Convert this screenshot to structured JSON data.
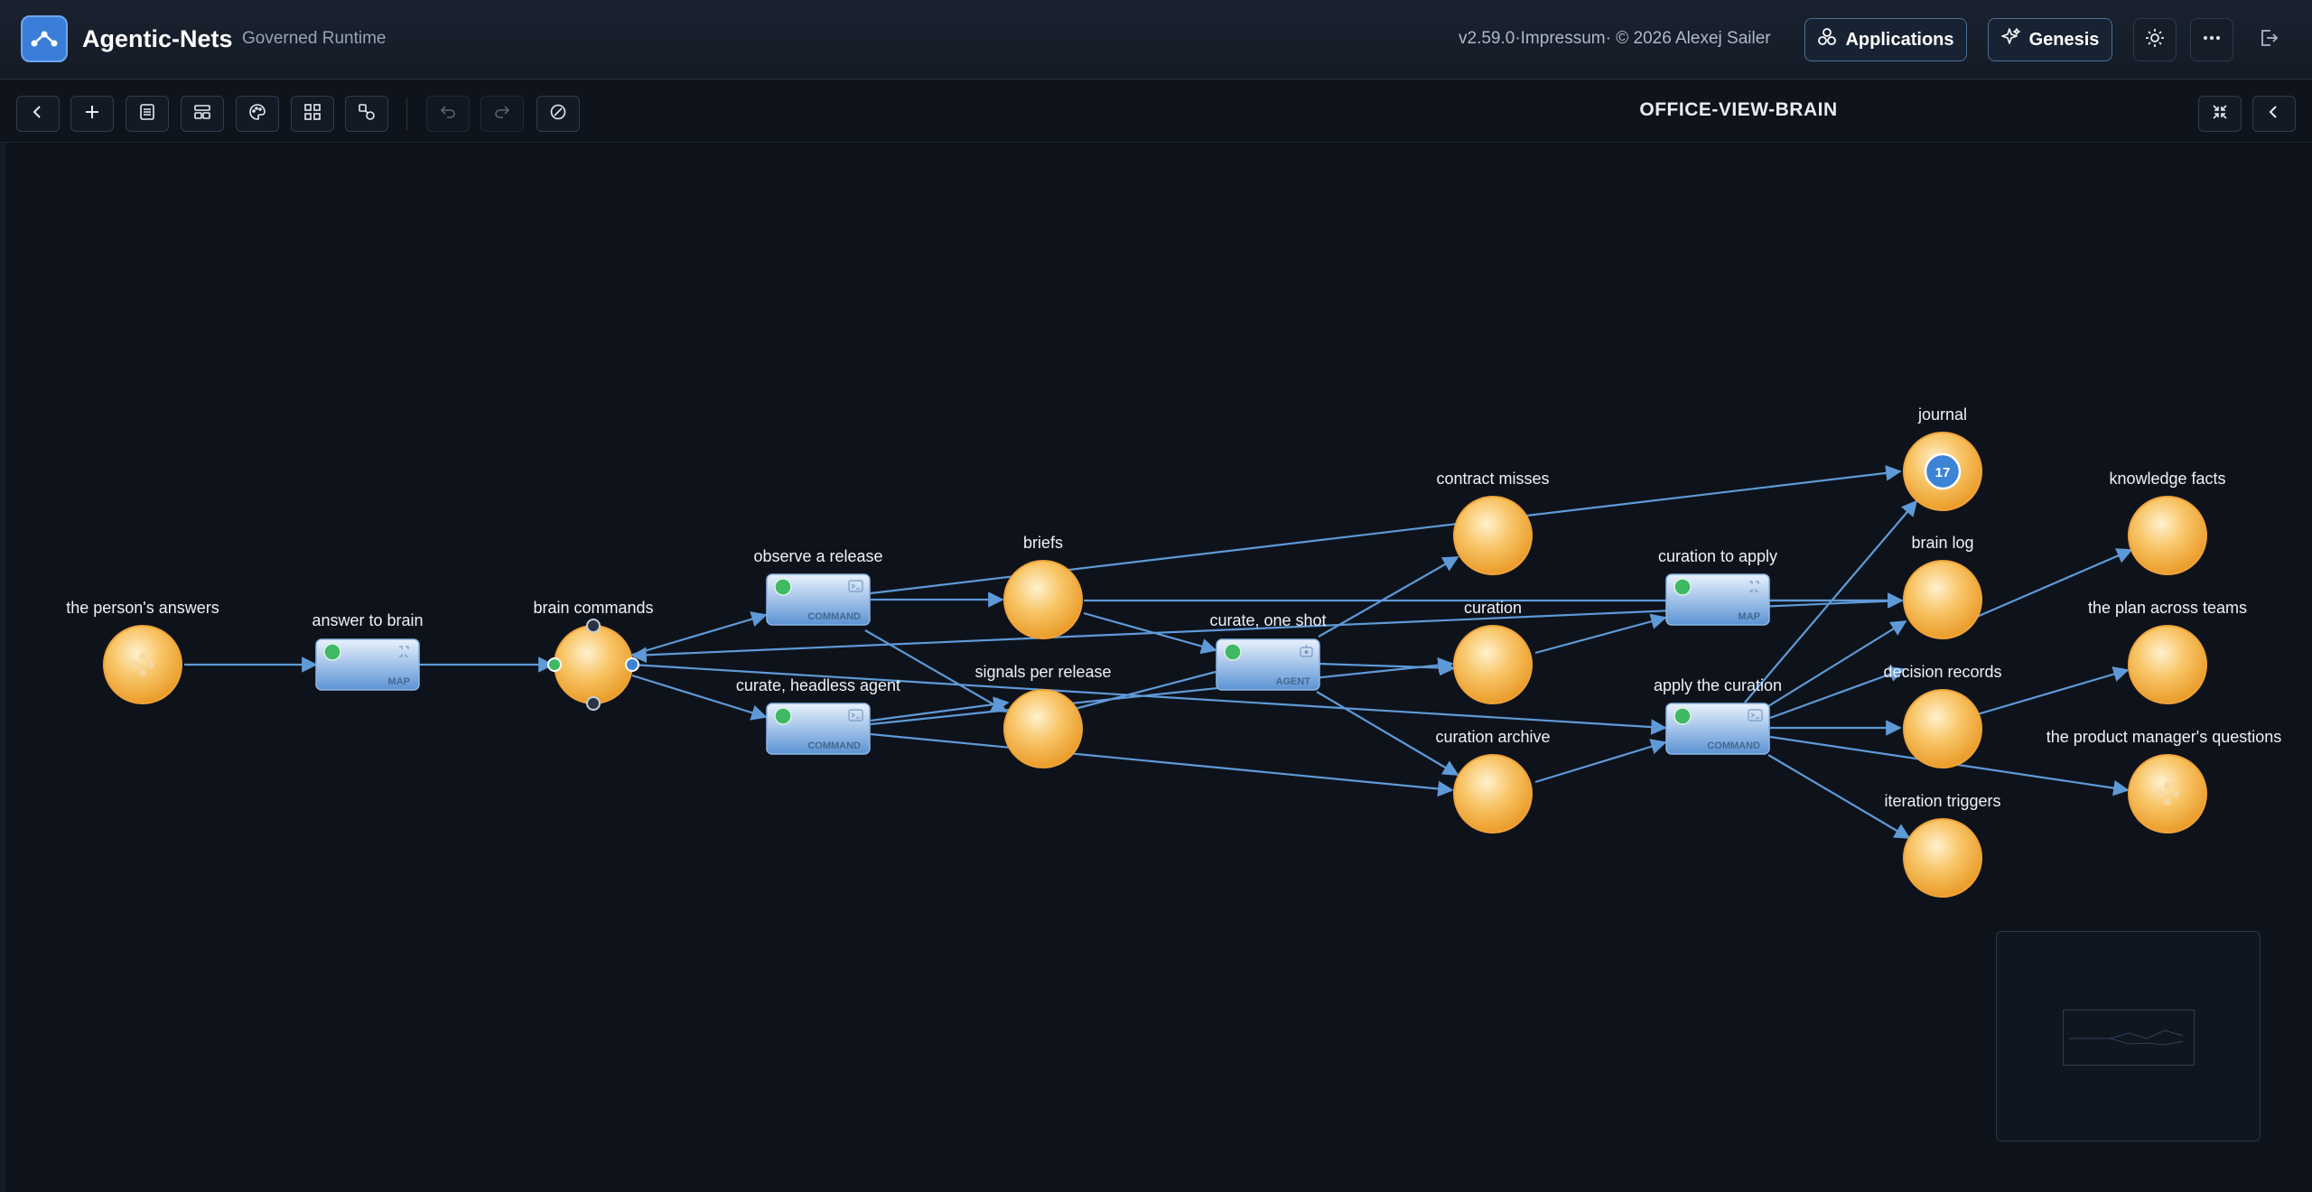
{
  "header": {
    "app_title": "Agentic-Nets",
    "app_subtitle": "Governed Runtime",
    "version_text": "v2.59.0·Impressum· © 2026 Alexej Sailer",
    "applications_label": "Applications",
    "genesis_label": "Genesis",
    "icons": [
      "app-logo-icon",
      "applications-icon",
      "genesis-sparkle-icon",
      "theme-sun-icon",
      "more-icon",
      "logout-icon"
    ]
  },
  "toolbar": {
    "net_title": "OFFICE-VIEW-BRAIN",
    "icons": [
      "back-icon",
      "add-icon",
      "document-list-icon",
      "layout-icon",
      "palette-icon",
      "grid-icon",
      "shapes-icon",
      "undo-icon",
      "redo-icon",
      "clear-icon",
      "collapse-icon",
      "collapse-panel-icon"
    ]
  },
  "places": [
    {
      "id": "p-answers",
      "label": "the person's answers",
      "type": "input"
    },
    {
      "id": "p-brain-commands",
      "label": "brain commands",
      "selected": true
    },
    {
      "id": "p-briefs",
      "label": "briefs"
    },
    {
      "id": "p-signals",
      "label": "signals per release"
    },
    {
      "id": "p-contract-misses",
      "label": "contract misses"
    },
    {
      "id": "p-curation",
      "label": "curation"
    },
    {
      "id": "p-curation-archive",
      "label": "curation archive"
    },
    {
      "id": "p-journal",
      "label": "journal",
      "tokens": "17"
    },
    {
      "id": "p-brain-log",
      "label": "brain log"
    },
    {
      "id": "p-decision-records",
      "label": "decision records"
    },
    {
      "id": "p-iteration-triggers",
      "label": "iteration triggers"
    },
    {
      "id": "p-knowledge-facts",
      "label": "knowledge facts"
    },
    {
      "id": "p-plan",
      "label": "the plan across teams"
    },
    {
      "id": "p-pm-questions",
      "label": "the product manager's questions",
      "type": "input"
    }
  ],
  "transitions": [
    {
      "id": "t-answer-to-brain",
      "label": "answer to brain",
      "kind": "MAP"
    },
    {
      "id": "t-observe",
      "label": "observe a release",
      "kind": "COMMAND"
    },
    {
      "id": "t-curate-headless",
      "label": "curate, headless agent",
      "kind": "COMMAND"
    },
    {
      "id": "t-curate-one-shot",
      "label": "curate, one shot",
      "kind": "AGENT"
    },
    {
      "id": "t-curation-to-apply",
      "label": "curation to apply",
      "kind": "MAP"
    },
    {
      "id": "t-apply",
      "label": "apply the curation",
      "kind": "COMMAND"
    }
  ],
  "colors": {
    "background": "#0e131b",
    "place_fill": "#f6b13e",
    "transition_fill": "#6a9fd8",
    "arc": "#5f9ad8",
    "enabled_dot": "#3fb964",
    "token_badge": "#3d84d6"
  }
}
